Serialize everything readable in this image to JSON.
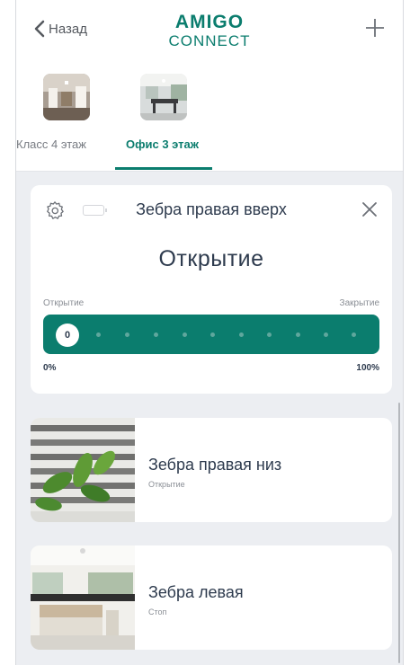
{
  "header": {
    "back_label": "Назад",
    "logo_line1": "AMIGO",
    "logo_line2": "CONNECT"
  },
  "rooms": [
    {
      "label": "Класс 4 этаж",
      "active": false
    },
    {
      "label": "Офис 3 этаж",
      "active": true
    }
  ],
  "device": {
    "title": "Зебра правая вверх",
    "status": "Открытие",
    "label_left": "Открытие",
    "label_right": "Закрытие",
    "position_value": "0",
    "pct_min": "0%",
    "pct_max": "100%"
  },
  "devices": [
    {
      "name": "Зебра правая низ",
      "status": "Открытие"
    },
    {
      "name": "Зебра левая",
      "status": "Стоп"
    }
  ],
  "colors": {
    "accent": "#0b7d6e",
    "text_dark": "#2e3b4e",
    "background": "#eceef2"
  }
}
